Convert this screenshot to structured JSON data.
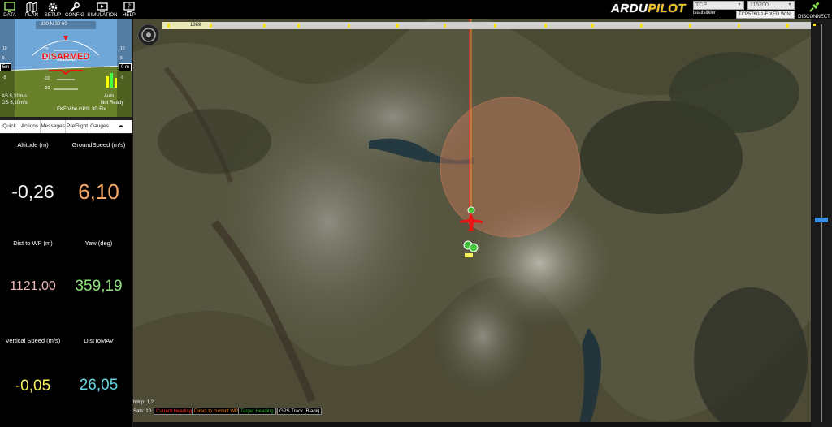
{
  "menu": {
    "items": [
      {
        "label": "DATA",
        "icon": "monitor-icon"
      },
      {
        "label": "PLAN",
        "icon": "map-icon"
      },
      {
        "label": "SETUP",
        "icon": "gear-icon"
      },
      {
        "label": "CONFIG",
        "icon": "wrench-icon"
      },
      {
        "label": "SIMULATION",
        "icon": "simulation-icon"
      },
      {
        "label": "HELP",
        "icon": "help-icon"
      }
    ],
    "brand": {
      "part1": "ARDU",
      "part2": "PILOT"
    },
    "istatistikler": "istatistikler",
    "connection_type": "TCP",
    "baud_rate": "115200",
    "device": "TCP5760-1-FIXED WIN",
    "disconnect_label": "DISCONNECT"
  },
  "hud": {
    "status": "DISARMED",
    "left_top": "5m",
    "right_top": "0 m",
    "as_line": "AS 5,31m/s",
    "gs_line": "GS 6,10m/s",
    "ekf_line": "EKF Vibe GPS: 3D Fix",
    "mode_line1": "Auto",
    "mode_line2": "Not Ready",
    "speed_ticks": [
      "10",
      "5",
      "0",
      "-5"
    ],
    "alt_ticks": [
      "10",
      "5",
      "0",
      "-5"
    ],
    "pitch_labels": [
      "20",
      "10",
      "-10",
      "-20"
    ],
    "heading_tape": "330 N 30 60"
  },
  "tabs": [
    "Quick",
    "Actions",
    "Messages",
    "PreFlight",
    "Gauges"
  ],
  "quick": {
    "cells": [
      {
        "label": "Altitude (m)",
        "value": "-0,26",
        "color": "#f3f3f3"
      },
      {
        "label": "GroundSpeed (m/s)",
        "value": "6,10",
        "color": "#f6a864"
      },
      {
        "label": "Dist to WP (m)",
        "value": "1121,00",
        "color": "#e8b6b6"
      },
      {
        "label": "Yaw (deg)",
        "value": "359,19",
        "color": "#8fe47a"
      },
      {
        "label": "Vertical Speed (m/s)",
        "value": "-0,05",
        "color": "#f3f05b"
      },
      {
        "label": "DistToMAV",
        "value": "26,05",
        "color": "#68d4e0"
      }
    ]
  },
  "map": {
    "timeline_label": "1369",
    "hdop": "hdop: 1,2",
    "sats": "Sats: 10",
    "legend": [
      {
        "label": "Current Heading",
        "color": "#ff2a2a"
      },
      {
        "label": "Direct to current WP",
        "color": "#ff8a1f"
      },
      {
        "label": "Target Heading",
        "color": "#3bb13b"
      },
      {
        "label": "GPS Track (Black)",
        "color": "#ffffff"
      }
    ]
  },
  "colors": {
    "accent_green": "#8be34d",
    "hud_ground": "#68812a",
    "hud_sky": "#6fa7d8",
    "wp_circle": "#c87a5a",
    "plane_red": "#e81515"
  }
}
